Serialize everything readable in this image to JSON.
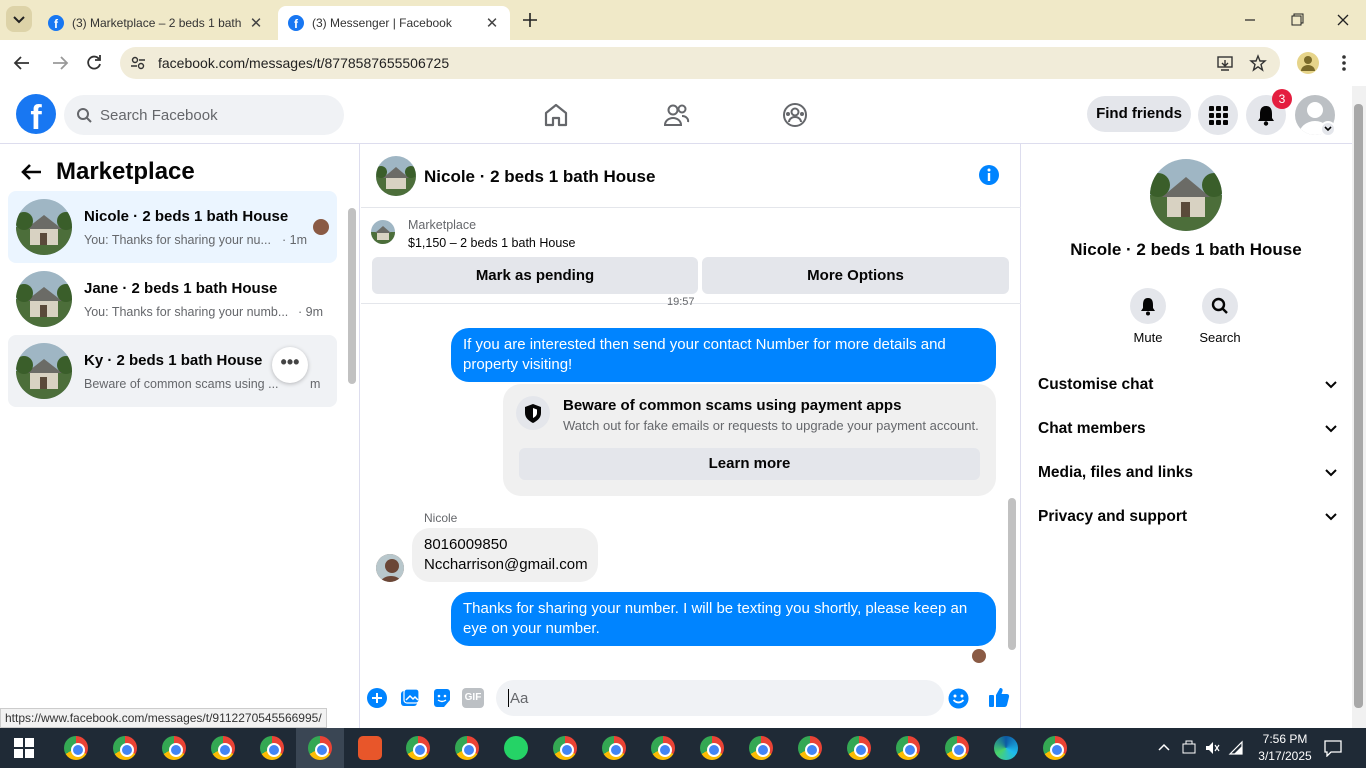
{
  "browser": {
    "tabs": [
      {
        "title": "(3) Marketplace – 2 beds 1 bath"
      },
      {
        "title": "(3) Messenger | Facebook"
      }
    ],
    "url": "facebook.com/messages/t/8778587655506725",
    "status_url": "https://www.facebook.com/messages/t/9112270545566995/"
  },
  "fb": {
    "search_placeholder": "Search Facebook",
    "find_friends": "Find friends",
    "notification_count": "3"
  },
  "left": {
    "title": "Marketplace",
    "conversations": [
      {
        "name": "Nicole · 2 beds 1 bath House",
        "preview": "You: Thanks for sharing your nu...",
        "time": "· 1m"
      },
      {
        "name": "Jane · 2 beds 1 bath House",
        "preview": "You: Thanks for sharing your numb...",
        "time": "· 9m"
      },
      {
        "name": "Ky · 2 beds 1 bath House",
        "preview": "Beware of common scams using ...",
        "time": "m"
      }
    ]
  },
  "chat": {
    "title": "Nicole · 2 beds 1 bath House",
    "listing_source": "Marketplace",
    "listing_price": "$1,150 – 2 beds 1 bath House",
    "mark_pending": "Mark as pending",
    "more_options": "More Options",
    "timestamp": "19:57",
    "msg_out_1": "If you are interested then send your contact Number  for more details and property visiting!",
    "scam_title": "Beware of common scams using payment apps",
    "scam_body": "Watch out for fake emails or requests to upgrade your payment account.",
    "learn_more": "Learn more",
    "sender_name": "Nicole",
    "msg_in_line1": "8016009850",
    "msg_in_line2": "Nccharrison@gmail.com",
    "msg_out_2": "Thanks for sharing your number. I will be texting you shortly, please keep an eye on your number.",
    "composer_placeholder": "Aa"
  },
  "right": {
    "name": "Nicole · 2 beds 1 bath House",
    "mute": "Mute",
    "search": "Search",
    "sections": [
      "Customise chat",
      "Chat members",
      "Media, files and links",
      "Privacy and support"
    ]
  },
  "taskbar": {
    "time": "7:56 PM",
    "date": "3/17/2025"
  },
  "colors": {
    "fb_blue": "#1877f2",
    "bubble_out": "#0084ff",
    "tabbar": "#f0e9c8",
    "taskbar": "#1f2a36"
  }
}
